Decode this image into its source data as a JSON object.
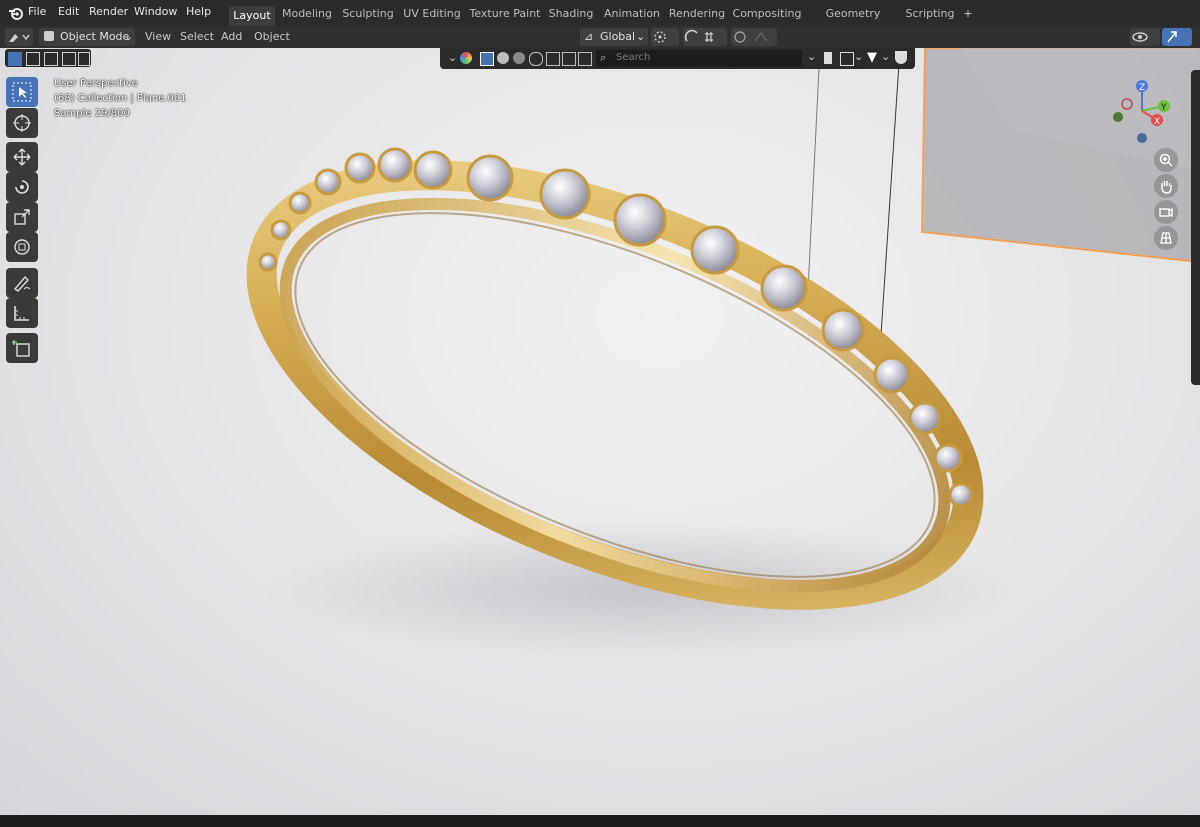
{
  "menu": {
    "items": [
      "File",
      "Edit",
      "Render",
      "Window",
      "Help"
    ]
  },
  "workspaces": {
    "tabs": [
      "Layout",
      "Modeling",
      "Sculpting",
      "UV Editing",
      "Texture Paint",
      "Shading",
      "Animation",
      "Rendering",
      "Compositing",
      "Geometry Nodes",
      "Scripting"
    ],
    "active": "Layout",
    "add_label": "+"
  },
  "header": {
    "mode": "Object Mode",
    "menus": [
      "View",
      "Select",
      "Add",
      "Object"
    ],
    "orientation": "Global"
  },
  "overlay_bar": {
    "search_placeholder": "Search"
  },
  "viewport_info": {
    "line1": "User Perspective",
    "line2": "(68) Collection | Plane.001",
    "line3": "Sample 29/800"
  },
  "gizmo": {
    "z": "Z",
    "y": "Y",
    "x": "X"
  },
  "toolbar": {
    "tools": [
      "select-box",
      "cursor",
      "move",
      "rotate",
      "scale",
      "transform",
      "annotate",
      "measure",
      "add-cube"
    ],
    "active_tool": "select-box"
  },
  "colors": {
    "accent": "#4772b3",
    "topbar": "#2b2b2b",
    "header": "#303030",
    "selection_outline": "#ff8a1f",
    "gold": "#d8b25a"
  }
}
